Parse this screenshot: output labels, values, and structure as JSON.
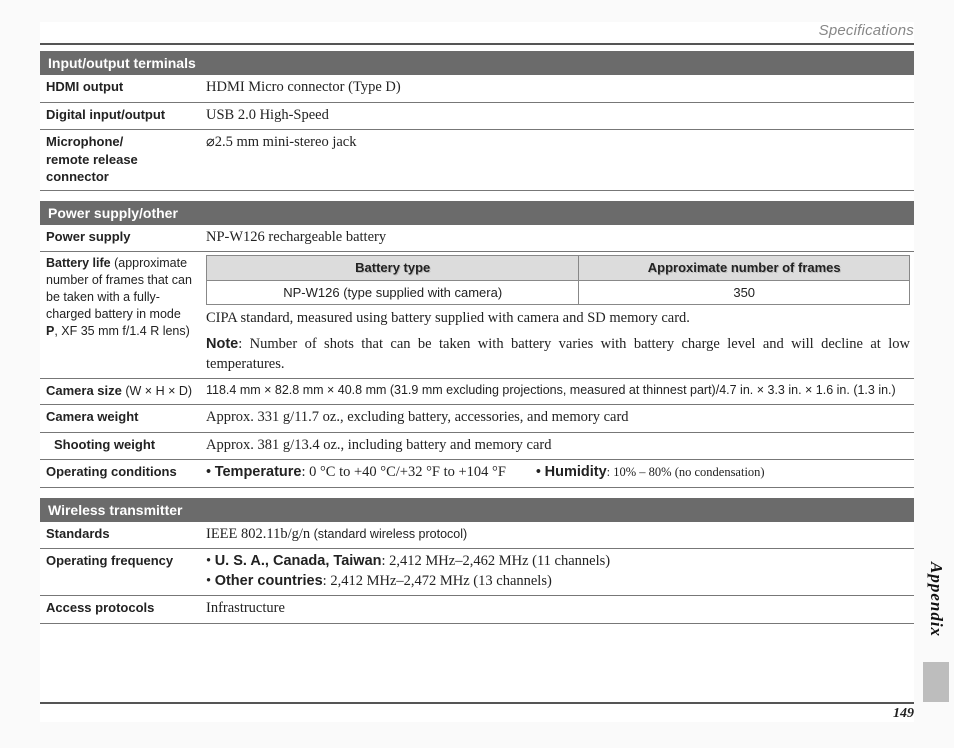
{
  "header": {
    "title": "Specifications"
  },
  "sections": {
    "io": {
      "bar": "Input/output terminals",
      "hdmi": {
        "label": "HDMI output",
        "value": "HDMI Micro connector (Type D)"
      },
      "digital": {
        "label": "Digital input/output",
        "value": "USB 2.0 High-Speed"
      },
      "mic": {
        "label_l1": "Microphone/",
        "label_l2": "remote release connector",
        "value": "⌀2.5 mm mini-stereo jack"
      }
    },
    "power": {
      "bar": "Power supply/other",
      "supply": {
        "label": "Power supply",
        "value": "NP-W126 rechargeable battery"
      },
      "battery_life": {
        "label_main": "Battery life",
        "label_sub": " (approximate number of frames that can be taken with a fully-charged battery in mode ",
        "label_mode": "P",
        "label_tail": ", XF 35 mm f/1.4 R lens)",
        "table": {
          "h1": "Battery type",
          "h2": "Approximate number of frames",
          "c1": "NP-W126 (type supplied with camera)",
          "c2": "350"
        },
        "cipa": "CIPA standard, measured using battery supplied with camera and SD memory card.",
        "note_label": "Note",
        "note_body": ": Number of shots that can be taken with battery varies with battery charge level and will decline at low temperatures."
      },
      "size": {
        "label_main": "Camera size",
        "label_sub": " (W × H × D)",
        "value": "118.4 mm × 82.8 mm × 40.8 mm (31.9 mm excluding projections, measured at thinnest part)/4.7 in. × 3.3 in. × 1.6 in. (1.3 in.)"
      },
      "weight": {
        "label": "Camera weight",
        "value": "Approx. 331 g/11.7 oz., excluding battery, accessories, and memory card"
      },
      "shoot_weight": {
        "label": "Shooting weight",
        "value": "Approx. 381 g/13.4 oz., including battery and memory card"
      },
      "operating": {
        "label": "Operating conditions",
        "temp_label": "Temperature",
        "temp_val": ": 0 °C to +40 °C/+32 °F to +104 °F",
        "hum_label": "Humidity",
        "hum_val": ": 10% – 80% (no condensation)"
      }
    },
    "wireless": {
      "bar": "Wireless transmitter",
      "standards": {
        "label": "Standards",
        "value_main": "IEEE 802.11b/g/n",
        "value_sub": " (standard wireless protocol)"
      },
      "freq": {
        "label": "Operating frequency",
        "l1_1_b": "U. S. A., Canada, Taiwan",
        "l1_1_r": ": 2,412 MHz–2,462 MHz (11 channels)",
        "l2_1_b": "Other countries",
        "l2_1_r": ": 2,412 MHz–2,472 MHz (13 channels)"
      },
      "access": {
        "label": "Access protocols",
        "value": "Infrastructure"
      }
    }
  },
  "side_tab": "Appendix",
  "page_number": "149"
}
